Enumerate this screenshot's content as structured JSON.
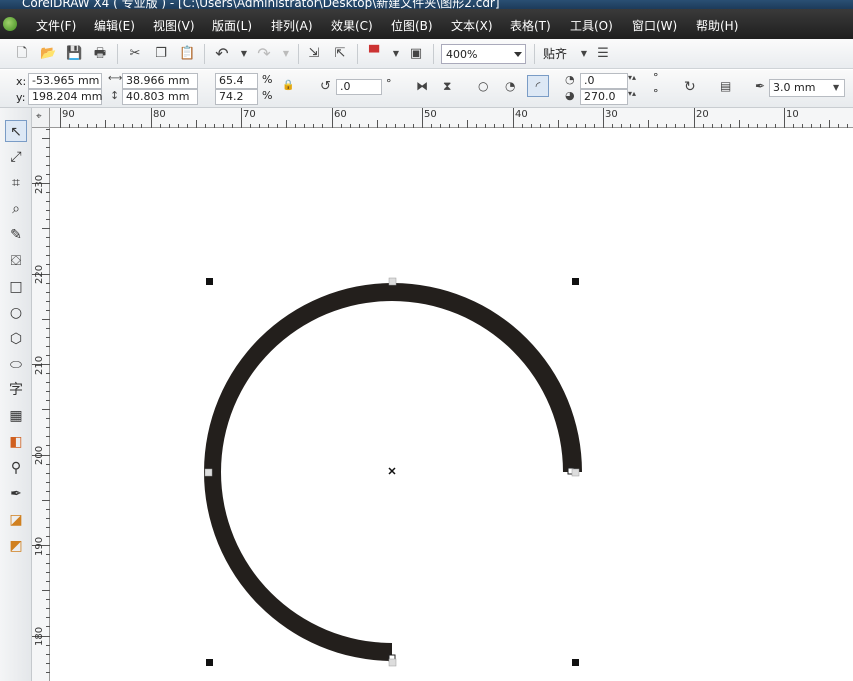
{
  "app": {
    "title": "CorelDRAW X4 ( 专业版 ) - [C:\\Users\\Administrator\\Desktop\\新建文件夹\\图形2.cdr]"
  },
  "menu": [
    "文件(F)",
    "编辑(E)",
    "视图(V)",
    "版面(L)",
    "排列(A)",
    "效果(C)",
    "位图(B)",
    "文本(X)",
    "表格(T)",
    "工具(O)",
    "窗口(W)",
    "帮助(H)"
  ],
  "toolbar": {
    "zoom": "400%",
    "snap_label": "贴齐"
  },
  "propbar": {
    "x_label": "x:",
    "y_label": "y:",
    "x_value": "-53.965 mm",
    "y_value": "198.204 mm",
    "width_value": "38.966 mm",
    "height_value": "40.803 mm",
    "scale_x": "65.4",
    "scale_y": "74.2",
    "percent": "%",
    "rotation": ".0",
    "degree": "°",
    "start_angle": ".0",
    "end_angle": "270.0",
    "outline_width": "3.0 mm"
  },
  "ruler": {
    "top_labels": [
      "90",
      "80",
      "70",
      "60",
      "50",
      "40",
      "30",
      "20",
      "10"
    ],
    "left_labels": [
      "230",
      "220",
      "210",
      "200",
      "190",
      "180"
    ]
  },
  "icons": {
    "toolbox": [
      "pick-tool-icon",
      "shape-tool-icon",
      "crop-tool-icon",
      "zoom-tool-icon",
      "freehand-tool-icon",
      "smart-fill-icon",
      "rectangle-tool-icon",
      "ellipse-tool-icon",
      "polygon-tool-icon",
      "basic-shapes-icon",
      "text-tool-icon",
      "table-tool-icon",
      "interactive-tool-icon",
      "eyedropper-tool-icon",
      "outline-tool-icon",
      "fill-tool-icon",
      "interactive-fill-icon"
    ]
  },
  "colors": {
    "arc_fill": "#231f1c",
    "menu_bg": "#2b2b2b"
  }
}
